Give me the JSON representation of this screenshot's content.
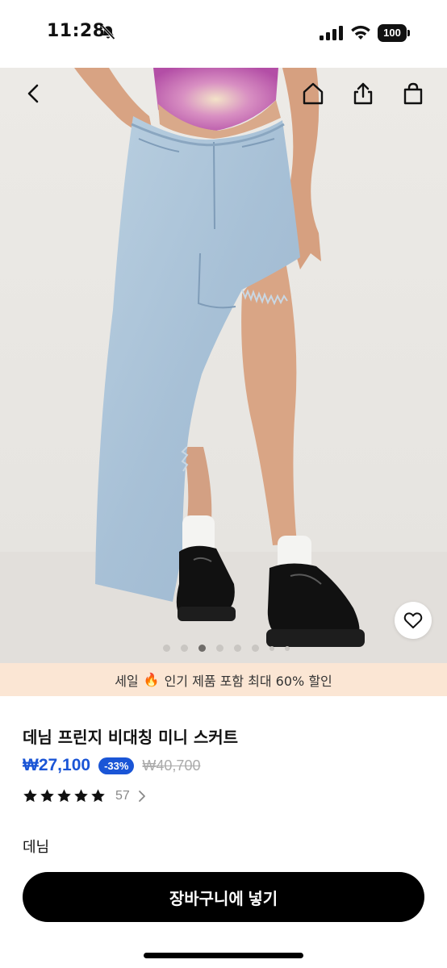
{
  "status_bar": {
    "time": "11:28",
    "battery": "100"
  },
  "hero": {
    "image_alt": "Denim fringe asymmetric skirt product photo",
    "icons": [
      "back-icon",
      "home-icon",
      "share-icon",
      "shopping-bag-icon",
      "heart-icon"
    ],
    "carousel": {
      "count": 8,
      "active_index": 2
    }
  },
  "promo": {
    "text_before": "세일",
    "emoji": "🔥",
    "text_after": "인기 제품 포함 최대 60% 할인",
    "background": "#fbe6d4"
  },
  "product": {
    "title": "데님 프린지 비대칭 미니 스커트",
    "price": "₩27,100",
    "discount": "-33%",
    "original_price": "₩40,700",
    "rating_stars": 5,
    "review_count": "57",
    "color_name": "데님",
    "accent_color": "#1a55d6"
  },
  "cta": {
    "add_to_cart": "장바구니에 넣기"
  }
}
